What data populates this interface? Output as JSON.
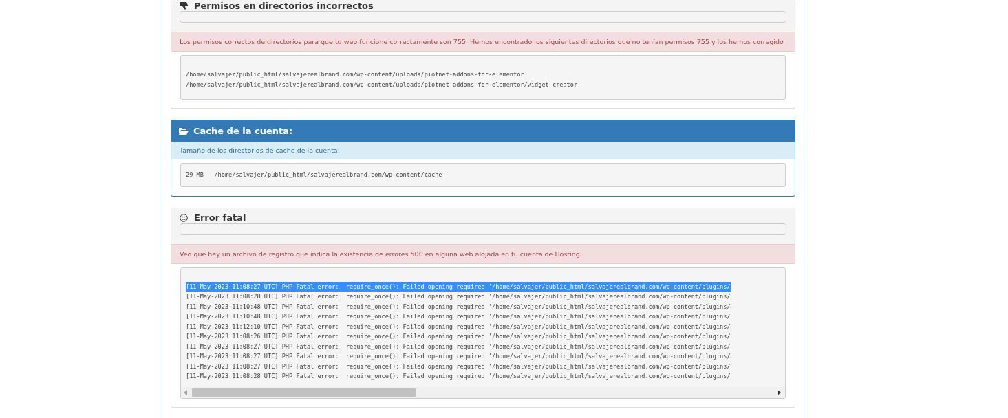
{
  "panels": [
    {
      "kind": "warning",
      "title": "Permisos en directorios incorrectos",
      "message": "Los permisos correctos de directorios para que tu web funcione correctamente son 755. Hemos encontrado los siguientes directorios que no tenían permisos 755 y los hemos corregido",
      "lines": [
        {
          "text": "/home/salvajer/public_html/salvajerealbrand.com/wp-content/uploads/piotnet-addons-for-elementor",
          "selected": false
        },
        {
          "text": "/home/salvajer/public_html/salvajerealbrand.com/wp-content/uploads/piotnet-addons-for-elementor/widget-creator",
          "selected": false
        }
      ]
    },
    {
      "kind": "info",
      "title": "Cache de la cuenta:",
      "message": "Tamaño de los directorios de cache de la cuenta:",
      "lines": [
        {
          "text": "29 MB   /home/salvajer/public_html/salvajerealbrand.com/wp-content/cache",
          "selected": false
        }
      ]
    },
    {
      "kind": "error",
      "title": "Error fatal",
      "message": "Veo que hay un archivo de registro que indica la existencia de errores 500 en alguna web alojada en tu cuenta de Hosting:",
      "scrollable": true,
      "lines": [
        {
          "text": "[11-May-2023 11:08:27 UTC] PHP Fatal error:  require_once(): Failed opening required '/home/salvajer/public_html/salvajerealbrand.com/wp-content/plugins/",
          "selected": true
        },
        {
          "text": "[11-May-2023 11:08:28 UTC] PHP Fatal error:  require_once(): Failed opening required '/home/salvajer/public_html/salvajerealbrand.com/wp-content/plugins/",
          "selected": false
        },
        {
          "text": "[11-May-2023 11:10:48 UTC] PHP Fatal error:  require_once(): Failed opening required '/home/salvajer/public_html/salvajerealbrand.com/wp-content/plugins/",
          "selected": false
        },
        {
          "text": "[11-May-2023 11:10:48 UTC] PHP Fatal error:  require_once(): Failed opening required '/home/salvajer/public_html/salvajerealbrand.com/wp-content/plugins/",
          "selected": false
        },
        {
          "text": "[11-May-2023 11:12:10 UTC] PHP Fatal error:  require_once(): Failed opening required '/home/salvajer/public_html/salvajerealbrand.com/wp-content/plugins/",
          "selected": false
        },
        {
          "text": "[11-May-2023 11:08:26 UTC] PHP Fatal error:  require_once(): Failed opening required '/home/salvajer/public_html/salvajerealbrand.com/wp-content/plugins/",
          "selected": false
        },
        {
          "text": "[11-May-2023 11:08:27 UTC] PHP Fatal error:  require_once(): Failed opening required '/home/salvajer/public_html/salvajerealbrand.com/wp-content/plugins/",
          "selected": false
        },
        {
          "text": "[11-May-2023 11:08:27 UTC] PHP Fatal error:  require_once(): Failed opening required '/home/salvajer/public_html/salvajerealbrand.com/wp-content/plugins/",
          "selected": false
        },
        {
          "text": "[11-May-2023 11:08:27 UTC] PHP Fatal error:  require_once(): Failed opening required '/home/salvajer/public_html/salvajerealbrand.com/wp-content/plugins/",
          "selected": false
        },
        {
          "text": "[11-May-2023 11:08:28 UTC] PHP Fatal error:  require_once(): Failed opening required '/home/salvajer/public_html/salvajerealbrand.com/wp-content/plugins/",
          "selected": false
        }
      ]
    }
  ]
}
